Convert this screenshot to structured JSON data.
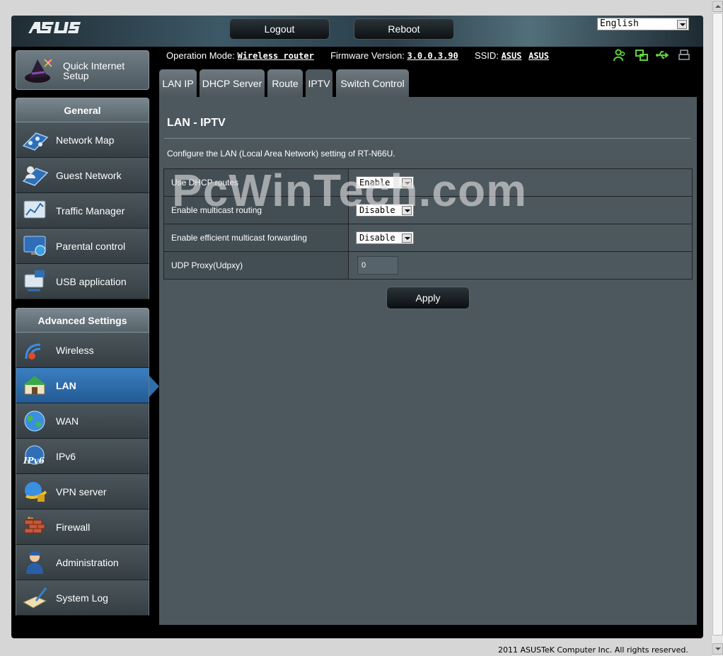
{
  "header": {
    "logo": "/ISUS",
    "logout_label": "Logout",
    "reboot_label": "Reboot",
    "language": "English"
  },
  "status": {
    "op_mode_label": "Operation Mode:",
    "op_mode_value": "Wireless router",
    "firmware_label": "Firmware Version:",
    "firmware_value": "3.0.0.3.90",
    "ssid_label": "SSID:",
    "ssid_values": [
      "ASUS",
      "ASUS"
    ],
    "icons": [
      "clients-icon",
      "network-icon",
      "usb-icon",
      "printer-icon"
    ]
  },
  "sidebar": {
    "quick_setup_label": "Quick Internet Setup",
    "general_heading": "General",
    "general_items": [
      {
        "label": "Network Map",
        "icon": "network-map-icon"
      },
      {
        "label": "Guest Network",
        "icon": "guest-network-icon"
      },
      {
        "label": "Traffic Manager",
        "icon": "traffic-manager-icon"
      },
      {
        "label": "Parental control",
        "icon": "parental-control-icon"
      },
      {
        "label": "USB application",
        "icon": "usb-application-icon"
      }
    ],
    "advanced_heading": "Advanced Settings",
    "advanced_items": [
      {
        "label": "Wireless",
        "icon": "wireless-icon"
      },
      {
        "label": "LAN",
        "icon": "lan-icon",
        "active": true
      },
      {
        "label": "WAN",
        "icon": "wan-globe-icon"
      },
      {
        "label": "IPv6",
        "icon": "ipv6-icon"
      },
      {
        "label": "VPN server",
        "icon": "vpn-server-icon"
      },
      {
        "label": "Firewall",
        "icon": "firewall-icon"
      },
      {
        "label": "Administration",
        "icon": "administration-icon"
      },
      {
        "label": "System Log",
        "icon": "system-log-icon"
      }
    ]
  },
  "tabs": [
    {
      "label": "LAN IP"
    },
    {
      "label": "DHCP Server"
    },
    {
      "label": "Route"
    },
    {
      "label": "IPTV",
      "active": true
    },
    {
      "label": "Switch Control"
    }
  ],
  "main": {
    "title": "LAN - IPTV",
    "description": "Configure the LAN (Local Area Network) setting of RT-N66U.",
    "rows": [
      {
        "label": "Use DHCP routes",
        "type": "select",
        "value": "Enable"
      },
      {
        "label": "Enable multicast routing",
        "type": "select",
        "value": "Disable"
      },
      {
        "label": "Enable efficient multicast forwarding",
        "type": "select",
        "value": "Disable"
      },
      {
        "label": "UDP Proxy(Udpxy)",
        "type": "text",
        "value": "0"
      }
    ],
    "apply_label": "Apply"
  },
  "watermark": "PcWinTech.com",
  "footer": "2011 ASUSTeK Computer Inc. All rights reserved.",
  "colors": {
    "accent_active": "#2f6fab",
    "content_bg": "#4d585e",
    "status_icon_green": "#5cd63a"
  }
}
